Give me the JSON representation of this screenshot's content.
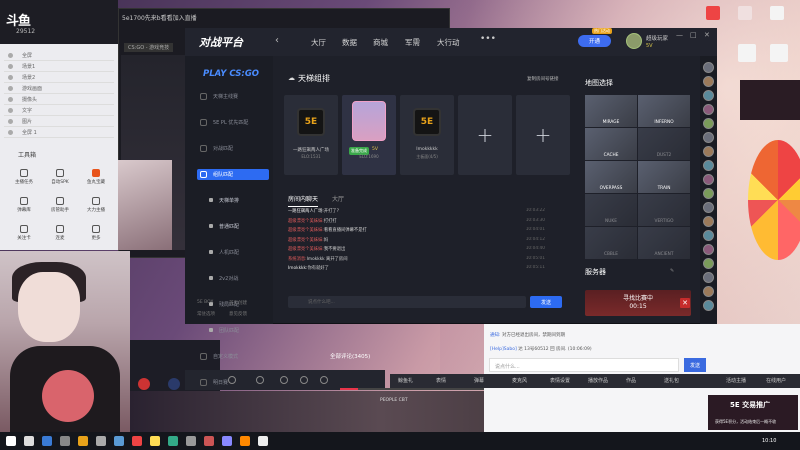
{
  "streamer_tool": {
    "logo": "斗鱼",
    "room_id": "29512",
    "section_label": "工具箱",
    "tools": [
      "主播任务",
      "自动SPK",
      "鱼丸宝藏",
      "弹幕库",
      "房管助手",
      "大力主播",
      "关注卡",
      "连麦",
      "更多"
    ],
    "rows": [
      "全屏",
      "场景1",
      "场景2",
      "游戏画面",
      "摄像头",
      "文字",
      "图片",
      "全屏 1"
    ],
    "colors": {
      "accent": "#e8541c"
    }
  },
  "window2": {
    "title": "5e1700先来b看看加入直播",
    "subtitle": "CS:GO - 游戏竞技"
  },
  "platform": {
    "logo": "对战平台",
    "nav": [
      "大厅",
      "数据",
      "商城",
      "军需",
      "大行动"
    ],
    "nav_more": "•••",
    "vip_label": "开通",
    "vip_badge": "热门活动",
    "user": {
      "name": "超级玩家",
      "level": "5V"
    },
    "window_controls": [
      "—",
      "□",
      "✕"
    ],
    "game_label": "PLAY CS:GO",
    "sidebar": [
      {
        "label": "天梯主线赛",
        "kind": "main"
      },
      {
        "label": "5E PL 优先匹配",
        "kind": "main"
      },
      {
        "label": "对战匹配",
        "kind": "main"
      },
      {
        "label": "组队匹配",
        "kind": "active"
      },
      {
        "label": "天梯单排",
        "kind": "sub"
      },
      {
        "label": "普通匹配",
        "kind": "sub"
      },
      {
        "label": "人机匹配",
        "kind": "sub"
      },
      {
        "label": "2v2对战",
        "kind": "sub"
      },
      {
        "label": "残局匹配",
        "kind": "sub"
      },
      {
        "label": "团队匹配",
        "kind": "sub"
      },
      {
        "label": "自定义模式",
        "kind": "main"
      },
      {
        "label": "明日赛",
        "kind": "main"
      }
    ],
    "sidebar_footer": [
      "5E BOX",
      "首页创建",
      "常驻选项",
      "意见反馈"
    ],
    "ladder_title": "天梯组排",
    "room_link": "复制房间号链接",
    "slots": [
      {
        "name": "一路狂飙两人广场",
        "elo": "ELO:1531",
        "type": "player"
      },
      {
        "name": "5V",
        "elo": "ELO:1690",
        "type": "me",
        "ready": "准备完成"
      },
      {
        "name": "Imokkkkk",
        "elo": "主板面(4/5)",
        "type": "player"
      },
      {
        "name": "+",
        "type": "empty"
      },
      {
        "name": "+",
        "type": "empty"
      }
    ],
    "chat_tabs": [
      "房间内聊天",
      "大厅"
    ],
    "chat_messages": [
      {
        "name": "一路狂飙两人广场:",
        "text": "开打了?",
        "time": "10:03:22",
        "color": "white"
      },
      {
        "name": "超级漂亮个美妹妹:",
        "text": "打打打",
        "time": "10:03:30",
        "color": "red"
      },
      {
        "name": "超级漂亮个美妹妹:",
        "text": "看看直播间弹幕不是打",
        "time": "10:04:01",
        "color": "red"
      },
      {
        "name": "超级漂亮个美妹妹:",
        "text": "妈",
        "time": "10:04:12",
        "color": "red"
      },
      {
        "name": "超级漂亮个美妹妹:",
        "text": "我不要退出",
        "time": "10:04:40",
        "color": "red"
      },
      {
        "name": "系统消息:",
        "text": "Imokkkk 离开了房间",
        "time": "10:05:01",
        "color": "red"
      },
      {
        "name": "Imokkkk:",
        "text": "你有就好了",
        "time": "10:05:11",
        "color": "white"
      }
    ],
    "chat_placeholder": "说点什么吧...",
    "send_label": "发送",
    "map_title": "地图选择",
    "maps": [
      {
        "name": "MIRAGE",
        "selected": true
      },
      {
        "name": "INFERNO",
        "selected": true
      },
      {
        "name": "CACHE",
        "selected": true
      },
      {
        "name": "DUST2",
        "selected": false
      },
      {
        "name": "OVERPASS",
        "selected": true
      },
      {
        "name": "TRAIN",
        "selected": true
      },
      {
        "name": "NUKE",
        "selected": false
      },
      {
        "name": "VERTIGO",
        "selected": false
      },
      {
        "name": "CBBLE",
        "selected": false
      },
      {
        "name": "ANCIENT",
        "selected": false
      }
    ],
    "server_title": "服务器",
    "server_edit": "✎",
    "matching_text": "寻找比赛中",
    "matching_time": "00:15",
    "cancel_label": "✕"
  },
  "danmu": {
    "lines": [
      {
        "prefix": "通知:",
        "text": "对方已经退出房间，禁期间到期"
      },
      {
        "prefix": "[Help]Sabo]",
        "text": "达 13号60512 回 房间. (10:06:09)"
      }
    ],
    "placeholder": "说点什么...",
    "send": "发送",
    "bar_items": [
      "鲸鱼礼",
      "表情",
      "弹幕",
      "麦克风",
      "表情设置",
      "播放作品",
      "作品",
      "送礼包"
    ],
    "gift_label": "活动主播",
    "online": "在线用户"
  },
  "stream": {
    "comments": "全部评论(3405)",
    "progress": 0.12,
    "scene_labels": [
      "PEOPLE CBT",
      "Zombies SE"
    ]
  },
  "promo": {
    "title": "5E 交易推广",
    "sub": "获得5E积分，活动结束后一概不收"
  },
  "taskbar": {
    "time": "10:10"
  }
}
